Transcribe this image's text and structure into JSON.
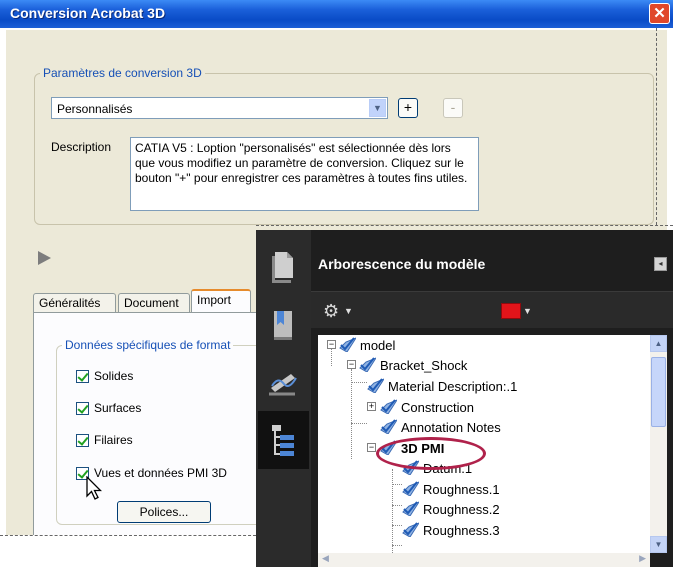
{
  "dialog": {
    "title": "Conversion Acrobat 3D",
    "close_glyph": "✕",
    "conversion_group": {
      "legend": "Paramètres de conversion 3D",
      "preset_value": "Personnalisés",
      "add_label": "+",
      "remove_label": "-",
      "description_label": "Description",
      "description_text": "CATIA V5 : Loption \"personalisés\" est sélectionnée dès lors que vous modifiez un paramètre de conversion. Cliquez sur le bouton \"+\" pour enregistrer ces paramètres à toutes fins utiles."
    },
    "tabs": [
      "Généralités",
      "Document",
      "Import"
    ],
    "active_tab": "Import",
    "format_group": {
      "legend": "Données spécifiques de format",
      "checkboxes": [
        {
          "label": "Solides",
          "checked": true
        },
        {
          "label": "Surfaces",
          "checked": true
        },
        {
          "label": "Filaires",
          "checked": true
        },
        {
          "label": "Vues et données PMI 3D",
          "checked": true
        }
      ],
      "fonts_button": "Polices..."
    }
  },
  "model_tree": {
    "title": "Arborescence du modèle",
    "collapse_glyph": "◂",
    "rail_icons": [
      "pages-icon",
      "bookmarks-icon",
      "signatures-icon",
      "model-tree-icon"
    ],
    "toolbar": {
      "options_icon": "gear-icon",
      "color_swatch": "#e1141a"
    },
    "nodes": [
      {
        "label": "model",
        "expander": "−"
      },
      {
        "label": "Bracket_Shock",
        "expander": "−"
      },
      {
        "label": "Material Description:.1",
        "expander": ""
      },
      {
        "label": "Construction",
        "expander": "+"
      },
      {
        "label": "Annotation Notes",
        "expander": ""
      },
      {
        "label": "3D PMI",
        "expander": "−",
        "highlighted": true
      },
      {
        "label": "Datum.1",
        "expander": ""
      },
      {
        "label": "Roughness.1",
        "expander": ""
      },
      {
        "label": "Roughness.2",
        "expander": ""
      },
      {
        "label": "Roughness.3",
        "expander": ""
      }
    ]
  },
  "colors": {
    "title_blue": "#0a4cc7",
    "legend_blue": "#1650b6",
    "highlight": "#b0224b",
    "panel_dark": "#1e1e1e"
  }
}
